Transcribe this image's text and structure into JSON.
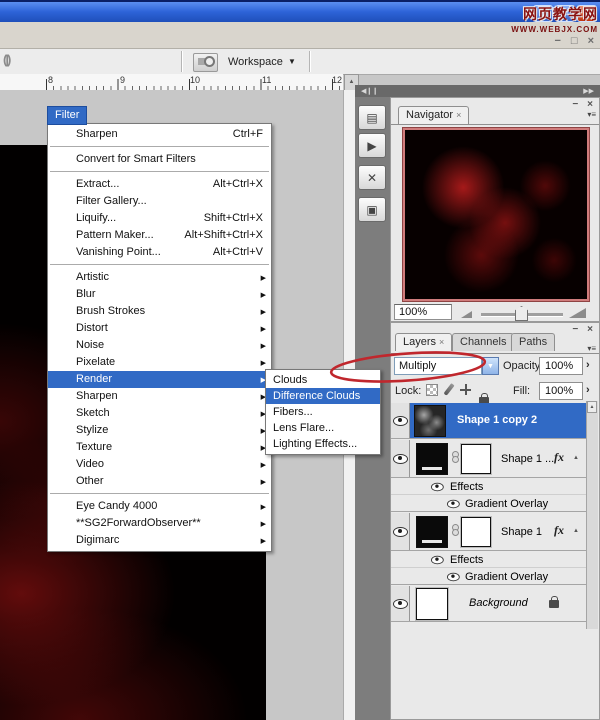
{
  "watermark": {
    "site_name": "网页教学网",
    "site_url": "WWW.WEBJX.COM"
  },
  "title_bar": {
    "minimize": "_",
    "maximize": "□",
    "close": "×"
  },
  "doc_window": {
    "minimize": "−",
    "restore": "□",
    "close": "×"
  },
  "options_bar": {
    "workspace_label": "Workspace",
    "dropdown_arrow": "▼"
  },
  "ruler": {
    "ticks": [
      "8",
      "9",
      "10",
      "11",
      "12"
    ],
    "scroll_arrow": "▲"
  },
  "dock": {
    "collapse_left": "◀❙❙",
    "collapse_right": "▶▶"
  },
  "icons": {
    "submenu_arrow": "▶",
    "dropdown_chevron": "▼",
    "dock_layer_comps": "▤",
    "dock_actions": "▶",
    "dock_tool_presets": "✕",
    "dock_info": "▣"
  },
  "filter_menu": {
    "title": "Filter",
    "items": [
      {
        "label": "Sharpen",
        "shortcut": "Ctrl+F"
      },
      {
        "separator": true
      },
      {
        "label": "Convert for Smart Filters"
      },
      {
        "separator": true
      },
      {
        "label": "Extract...",
        "shortcut": "Alt+Ctrl+X"
      },
      {
        "label": "Filter Gallery..."
      },
      {
        "label": "Liquify...",
        "shortcut": "Shift+Ctrl+X"
      },
      {
        "label": "Pattern Maker...",
        "shortcut": "Alt+Shift+Ctrl+X"
      },
      {
        "label": "Vanishing Point...",
        "shortcut": "Alt+Ctrl+V"
      },
      {
        "separator": true
      },
      {
        "label": "Artistic",
        "submenu": true
      },
      {
        "label": "Blur",
        "submenu": true
      },
      {
        "label": "Brush Strokes",
        "submenu": true
      },
      {
        "label": "Distort",
        "submenu": true
      },
      {
        "label": "Noise",
        "submenu": true
      },
      {
        "label": "Pixelate",
        "submenu": true
      },
      {
        "label": "Render",
        "submenu": true,
        "highlighted": true
      },
      {
        "label": "Sharpen",
        "submenu": true
      },
      {
        "label": "Sketch",
        "submenu": true
      },
      {
        "label": "Stylize",
        "submenu": true
      },
      {
        "label": "Texture",
        "submenu": true
      },
      {
        "label": "Video",
        "submenu": true
      },
      {
        "label": "Other",
        "submenu": true
      },
      {
        "separator": true
      },
      {
        "label": "Eye Candy 4000",
        "submenu": true
      },
      {
        "label": "**SG2ForwardObserver**",
        "submenu": true
      },
      {
        "label": "Digimarc",
        "submenu": true
      }
    ]
  },
  "render_submenu": {
    "items": [
      {
        "label": "Clouds"
      },
      {
        "label": "Difference Clouds",
        "highlighted": true
      },
      {
        "label": "Fibers..."
      },
      {
        "label": "Lens Flare..."
      },
      {
        "label": "Lighting Effects..."
      }
    ]
  },
  "navigator": {
    "tab_label": "Navigator",
    "tab_close": "×",
    "minimize": "−",
    "close": "×",
    "panel_menu": "▾≡",
    "zoom_value": "100%"
  },
  "layers_panel": {
    "minimize": "−",
    "close": "×",
    "panel_menu": "▾≡",
    "tabs": [
      {
        "label": "Layers",
        "close": "×",
        "active": true
      },
      {
        "label": "Channels"
      },
      {
        "label": "Paths"
      }
    ],
    "blend_mode": "Multiply",
    "opacity_label": "Opacity:",
    "opacity_value": "100%",
    "lock_label": "Lock:",
    "fill_label": "Fill:",
    "fill_value": "100%",
    "value_arrow": "›",
    "fx_badge": "fx",
    "collapse_arrow": "▲",
    "scroll_up_arrow": "▲",
    "layers": [
      {
        "name": "Shape 1 copy 2",
        "selected": true
      },
      {
        "name": "Shape 1 ...",
        "has_fx": true,
        "effects_label": "Effects",
        "style_label": "Gradient Overlay"
      },
      {
        "name": "Shape 1",
        "has_fx": true,
        "effects_label": "Effects",
        "style_label": "Gradient Overlay"
      },
      {
        "name": "Background",
        "locked": true
      }
    ]
  },
  "colors": {
    "selection_blue": "#316ac5",
    "annotation_red": "#c0272d",
    "title_bar_blue": "#2d63d8",
    "canvas_red": "#5a0a0a"
  }
}
